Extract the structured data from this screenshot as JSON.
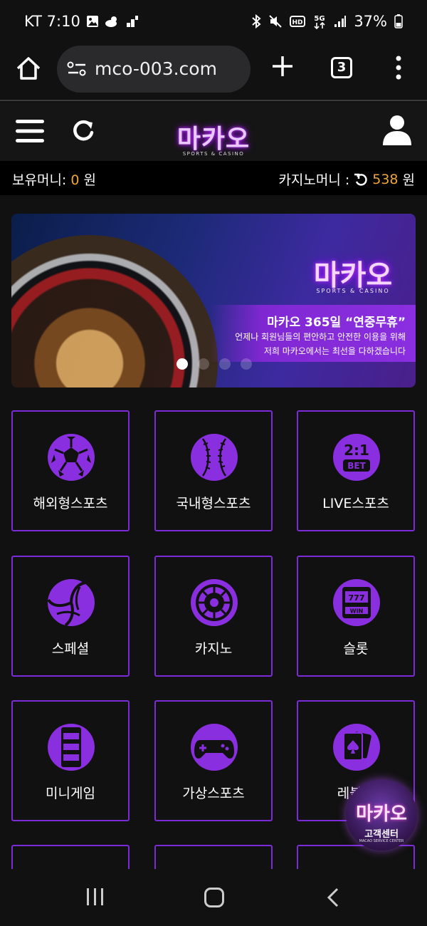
{
  "status_bar": {
    "carrier_time": "KT 7:10",
    "battery": "37%",
    "icons": [
      "image-icon",
      "weather-icon",
      "signal-small-icon",
      "bluetooth-icon",
      "mute-icon",
      "hd-icon",
      "5g-icon",
      "signal-icon",
      "battery-icon"
    ]
  },
  "browser": {
    "url": "mco-003.com",
    "tab_count": "3"
  },
  "header": {
    "logo_text": "마카오",
    "logo_sub": "SPORTS & CASINO"
  },
  "balance": {
    "money_label": "보유머니:",
    "money_value": "0",
    "money_unit": "원",
    "casino_label": "카지노머니 :",
    "casino_value": "538",
    "casino_unit": "원"
  },
  "banner": {
    "logo_text": "마카오",
    "logo_sub": "SPORTS & CASINO",
    "headline": "마카오 365일 “연중무휴”",
    "line1": "언제나 회원님들의 편안하고 안전한 이용을 위해",
    "line2": "저희 마카오에서는 최선을 다하겠습니다",
    "slide_count": 4,
    "active_slide": 1
  },
  "menu_tiles": [
    {
      "label": "해외형스포츠",
      "icon": "soccer-ball-icon"
    },
    {
      "label": "국내형스포츠",
      "icon": "baseball-icon"
    },
    {
      "label": "LIVE스포츠",
      "icon": "bet-icon"
    },
    {
      "label": "스페셜",
      "icon": "volleyball-icon"
    },
    {
      "label": "카지노",
      "icon": "roulette-icon"
    },
    {
      "label": "슬롯",
      "icon": "slot-machine-icon"
    },
    {
      "label": "미니게임",
      "icon": "minigame-icon"
    },
    {
      "label": "가상스포츠",
      "icon": "gamepad-icon"
    },
    {
      "label": "레볼루",
      "icon": "cards-icon"
    }
  ],
  "customer_service": {
    "title": "마카오",
    "subtitle": "고객센터",
    "tiny": "MACAO SERVICE CENTER"
  },
  "colors": {
    "accent": "#8a2fe0",
    "tile_border": "#7c2bd9",
    "money_value": "#f0a43a"
  }
}
